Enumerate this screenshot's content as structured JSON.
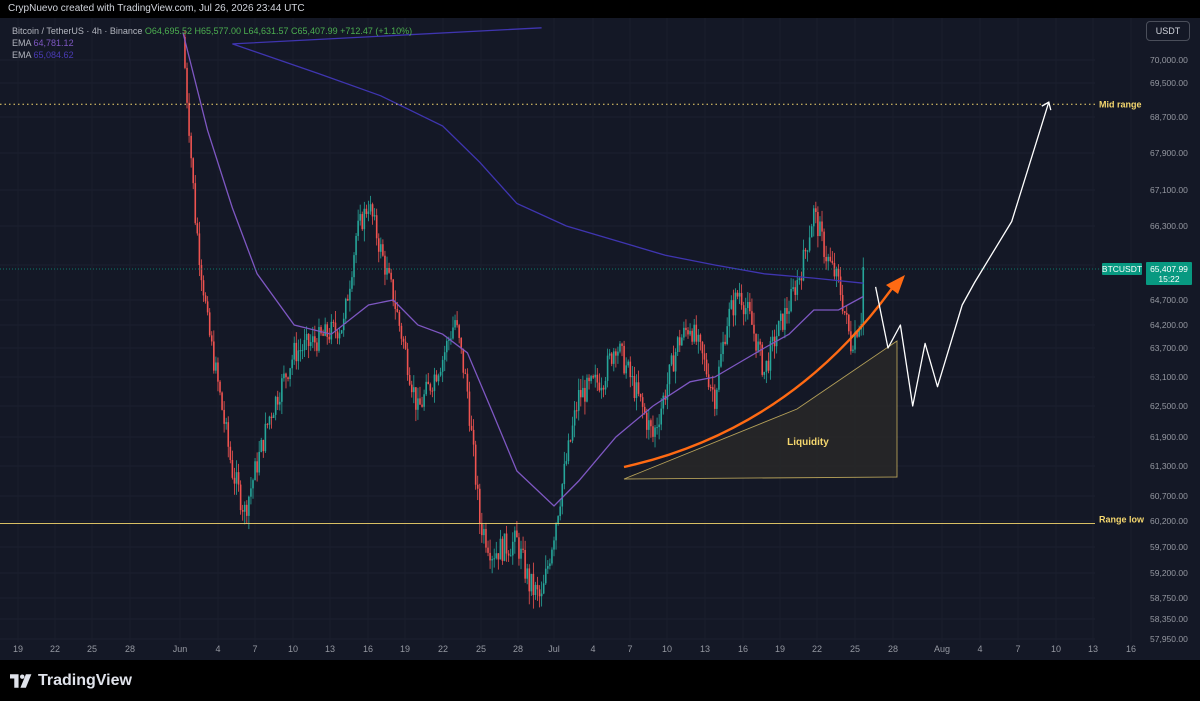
{
  "header": {
    "attribution": "CrypNuevo created with TradingView.com, Jul 26, 2026 23:44 UTC"
  },
  "legend": {
    "symbol": "Bitcoin / TetherUS · 4h · Binance",
    "ohlc": "O64,695.52  H65,577.00  L64,631.57  C65,407.99  +712.47 (+1.10%)",
    "ema1_label": "EMA",
    "ema1_value": "64,781.12",
    "ema2_label": "EMA",
    "ema2_value": "65,084.62"
  },
  "currency_button": "USDT",
  "brand": {
    "name": "TradingView"
  },
  "colors": {
    "background": "#141826",
    "up": "#26a69a",
    "down": "#ef5350",
    "ema_fast": "#7e57c2",
    "ema_slow": "#3f35b0",
    "annotation": "#f5d76e",
    "arrow": "#ff6a13",
    "price_tag": "#089981"
  },
  "chart_data": {
    "type": "candlestick",
    "title": "",
    "timeframe": "4h",
    "ylim": [
      57950,
      70800
    ],
    "y_ticks": [
      "70,000.00",
      "69,500.00",
      "68,700.00",
      "67,900.00",
      "67,100.00",
      "66,300.00",
      "65,500.00",
      "64,700.00",
      "64,200.00",
      "63,700.00",
      "63,100.00",
      "62,500.00",
      "61,900.00",
      "61,300.00",
      "60,700.00",
      "60,200.00",
      "59,700.00",
      "59,200.00",
      "58,750.00",
      "58,350.00",
      "57,950.00"
    ],
    "x_ticks": [
      "19",
      "22",
      "25",
      "28",
      "Jun",
      "4",
      "7",
      "10",
      "13",
      "16",
      "19",
      "22",
      "25",
      "28",
      "Jul",
      "4",
      "7",
      "10",
      "13",
      "16",
      "19",
      "22",
      "25",
      "28",
      "Aug",
      "4",
      "7",
      "10",
      "13",
      "16"
    ],
    "close_path": [
      [
        "Jun 1",
        70500
      ],
      [
        "Jun 2",
        66500
      ],
      [
        "Jun 3",
        64200
      ],
      [
        "Jun 5",
        61200
      ],
      [
        "Jun 6",
        60400
      ],
      [
        "Jun 8",
        62300
      ],
      [
        "Jun 10",
        63600
      ],
      [
        "Jun 12",
        63900
      ],
      [
        "Jun 14",
        64200
      ],
      [
        "Jun 15",
        66100
      ],
      [
        "Jun 16",
        66800
      ],
      [
        "Jun 18",
        64800
      ],
      [
        "Jun 20",
        62400
      ],
      [
        "Jun 22",
        63500
      ],
      [
        "Jun 23",
        64300
      ],
      [
        "Jun 24",
        62800
      ],
      [
        "Jun 25",
        60200
      ],
      [
        "Jun 26",
        59600
      ],
      [
        "Jun 28",
        59800
      ],
      [
        "Jun 29",
        59000
      ],
      [
        "Jun 30",
        58700
      ],
      [
        "Jul 1",
        60000
      ],
      [
        "Jul 2",
        61400
      ],
      [
        "Jul 3",
        62700
      ],
      [
        "Jul 5",
        63100
      ],
      [
        "Jul 6",
        63800
      ],
      [
        "Jul 7",
        63200
      ],
      [
        "Jul 9",
        61900
      ],
      [
        "Jul 10",
        62800
      ],
      [
        "Jul 11",
        63800
      ],
      [
        "Jul 12",
        64200
      ],
      [
        "Jul 13",
        63500
      ],
      [
        "Jul 14",
        62700
      ],
      [
        "Jul 15",
        64300
      ],
      [
        "Jul 16",
        64900
      ],
      [
        "Jul 17",
        64200
      ],
      [
        "Jul 18",
        63200
      ],
      [
        "Jul 19",
        64000
      ],
      [
        "Jul 20",
        64600
      ],
      [
        "Jul 21",
        65400
      ],
      [
        "Jul 22",
        66600
      ],
      [
        "Jul 23",
        65700
      ],
      [
        "Jul 24",
        65100
      ],
      [
        "Jul 25",
        63800
      ],
      [
        "Jul 26",
        64500
      ],
      [
        "Jul 26",
        65408
      ]
    ],
    "series": [
      {
        "name": "EMA",
        "values": [
          [
            "Jun 1",
            70600
          ],
          [
            "Jun 3",
            68400
          ],
          [
            "Jun 5",
            66700
          ],
          [
            "Jun 7",
            65300
          ],
          [
            "Jun 10",
            64200
          ],
          [
            "Jun 13",
            64000
          ],
          [
            "Jun 16",
            64600
          ],
          [
            "Jun 18",
            64700
          ],
          [
            "Jun 20",
            64200
          ],
          [
            "Jun 22",
            64000
          ],
          [
            "Jun 24",
            63600
          ],
          [
            "Jun 26",
            62400
          ],
          [
            "Jun 28",
            61200
          ],
          [
            "Jul 1",
            60500
          ],
          [
            "Jul 3",
            61000
          ],
          [
            "Jul 6",
            61900
          ],
          [
            "Jul 9",
            62500
          ],
          [
            "Jul 12",
            63000
          ],
          [
            "Jul 14",
            63100
          ],
          [
            "Jul 16",
            63400
          ],
          [
            "Jul 18",
            63700
          ],
          [
            "Jul 20",
            64000
          ],
          [
            "Jul 22",
            64500
          ],
          [
            "Jul 24",
            64500
          ],
          [
            "Jul 26",
            64781
          ]
        ]
      },
      {
        "name": "EMA",
        "values": [
          [
            "May 31",
            70700
          ],
          [
            "Jun 5",
            70350
          ],
          [
            "Jun 12",
            69700
          ],
          [
            "Jun 17",
            69200
          ],
          [
            "Jun 22",
            68500
          ],
          [
            "Jun 25",
            67700
          ],
          [
            "Jun 28",
            66800
          ],
          [
            "Jul 2",
            66300
          ],
          [
            "Jul 6",
            66000
          ],
          [
            "Jul 10",
            65700
          ],
          [
            "Jul 14",
            65500
          ],
          [
            "Jul 18",
            65300
          ],
          [
            "Jul 22",
            65200
          ],
          [
            "Jul 26",
            65085
          ]
        ]
      }
    ],
    "last_price": {
      "label": "BTCUSDT",
      "price": "65,407.99",
      "countdown": "15:22"
    },
    "annotations": [
      {
        "text": "Mid range",
        "price": 69000
      },
      {
        "text": "Range low",
        "price": 60150
      },
      {
        "text": "Liquidity"
      }
    ],
    "projection": [
      [
        "Jul 27",
        65000
      ],
      [
        "Jul 28",
        63700
      ],
      [
        "Jul 29",
        64200
      ],
      [
        "Jul 30",
        62500
      ],
      [
        "Jul 31",
        63800
      ],
      [
        "Aug 1",
        62900
      ],
      [
        "Aug 3",
        64600
      ],
      [
        "Aug 4",
        65100
      ],
      [
        "Aug 7",
        66400
      ],
      [
        "Aug 10",
        69050
      ]
    ]
  }
}
